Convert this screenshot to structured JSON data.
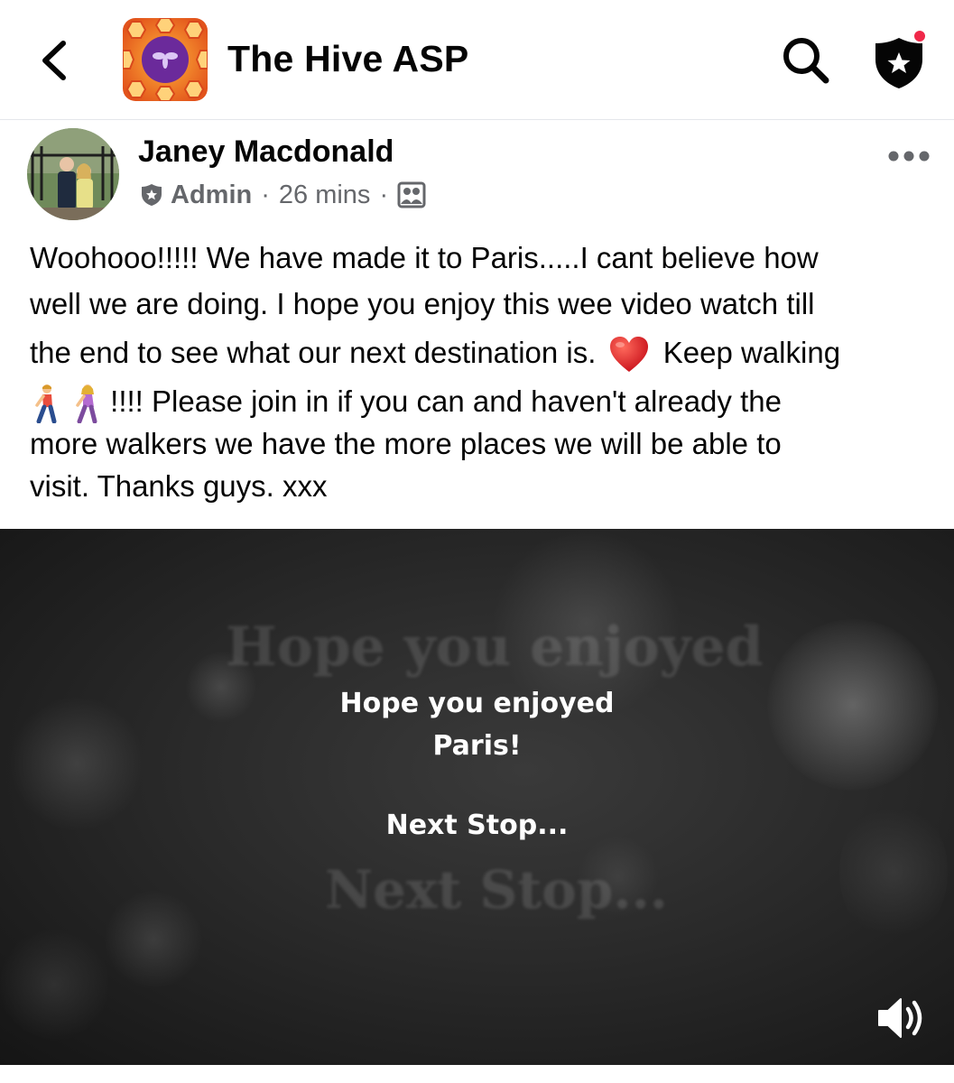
{
  "header": {
    "back_icon": "chevron-left-icon",
    "group_name": "The Hive ASP",
    "search_icon": "search-icon",
    "admin_icon": "admin-shield-star-icon",
    "notification_dot_color": "#f02849"
  },
  "post": {
    "author": "Janey Macdonald",
    "role": "Admin",
    "time": "26 mins",
    "audience_icon": "group-members-icon",
    "more_icon": "more-horizontal-icon",
    "text": {
      "line1": "Woohooo!!!!!  We have made it to Paris.....I cant believe how",
      "line2": "well we are doing.  I hope you enjoy this wee video watch till",
      "line3a": "the end to see what our next destination is.",
      "line3b": "Keep walking",
      "line4": "!!!!  Please join in if you can and haven't already the",
      "line5": "more walkers we have the more places we will be able to",
      "line6": "visit. Thanks guys. xxx"
    },
    "emojis": [
      "heart-emoji",
      "person-walking-emoji",
      "woman-walking-emoji"
    ]
  },
  "video": {
    "caption_line1": "Hope you enjoyed",
    "caption_line2": "Paris!",
    "caption_line3": "Next Stop...",
    "ghost_text_1": "Hope you enjoyed",
    "ghost_text_2": "Next Stop...",
    "sound_icon": "volume-icon"
  }
}
